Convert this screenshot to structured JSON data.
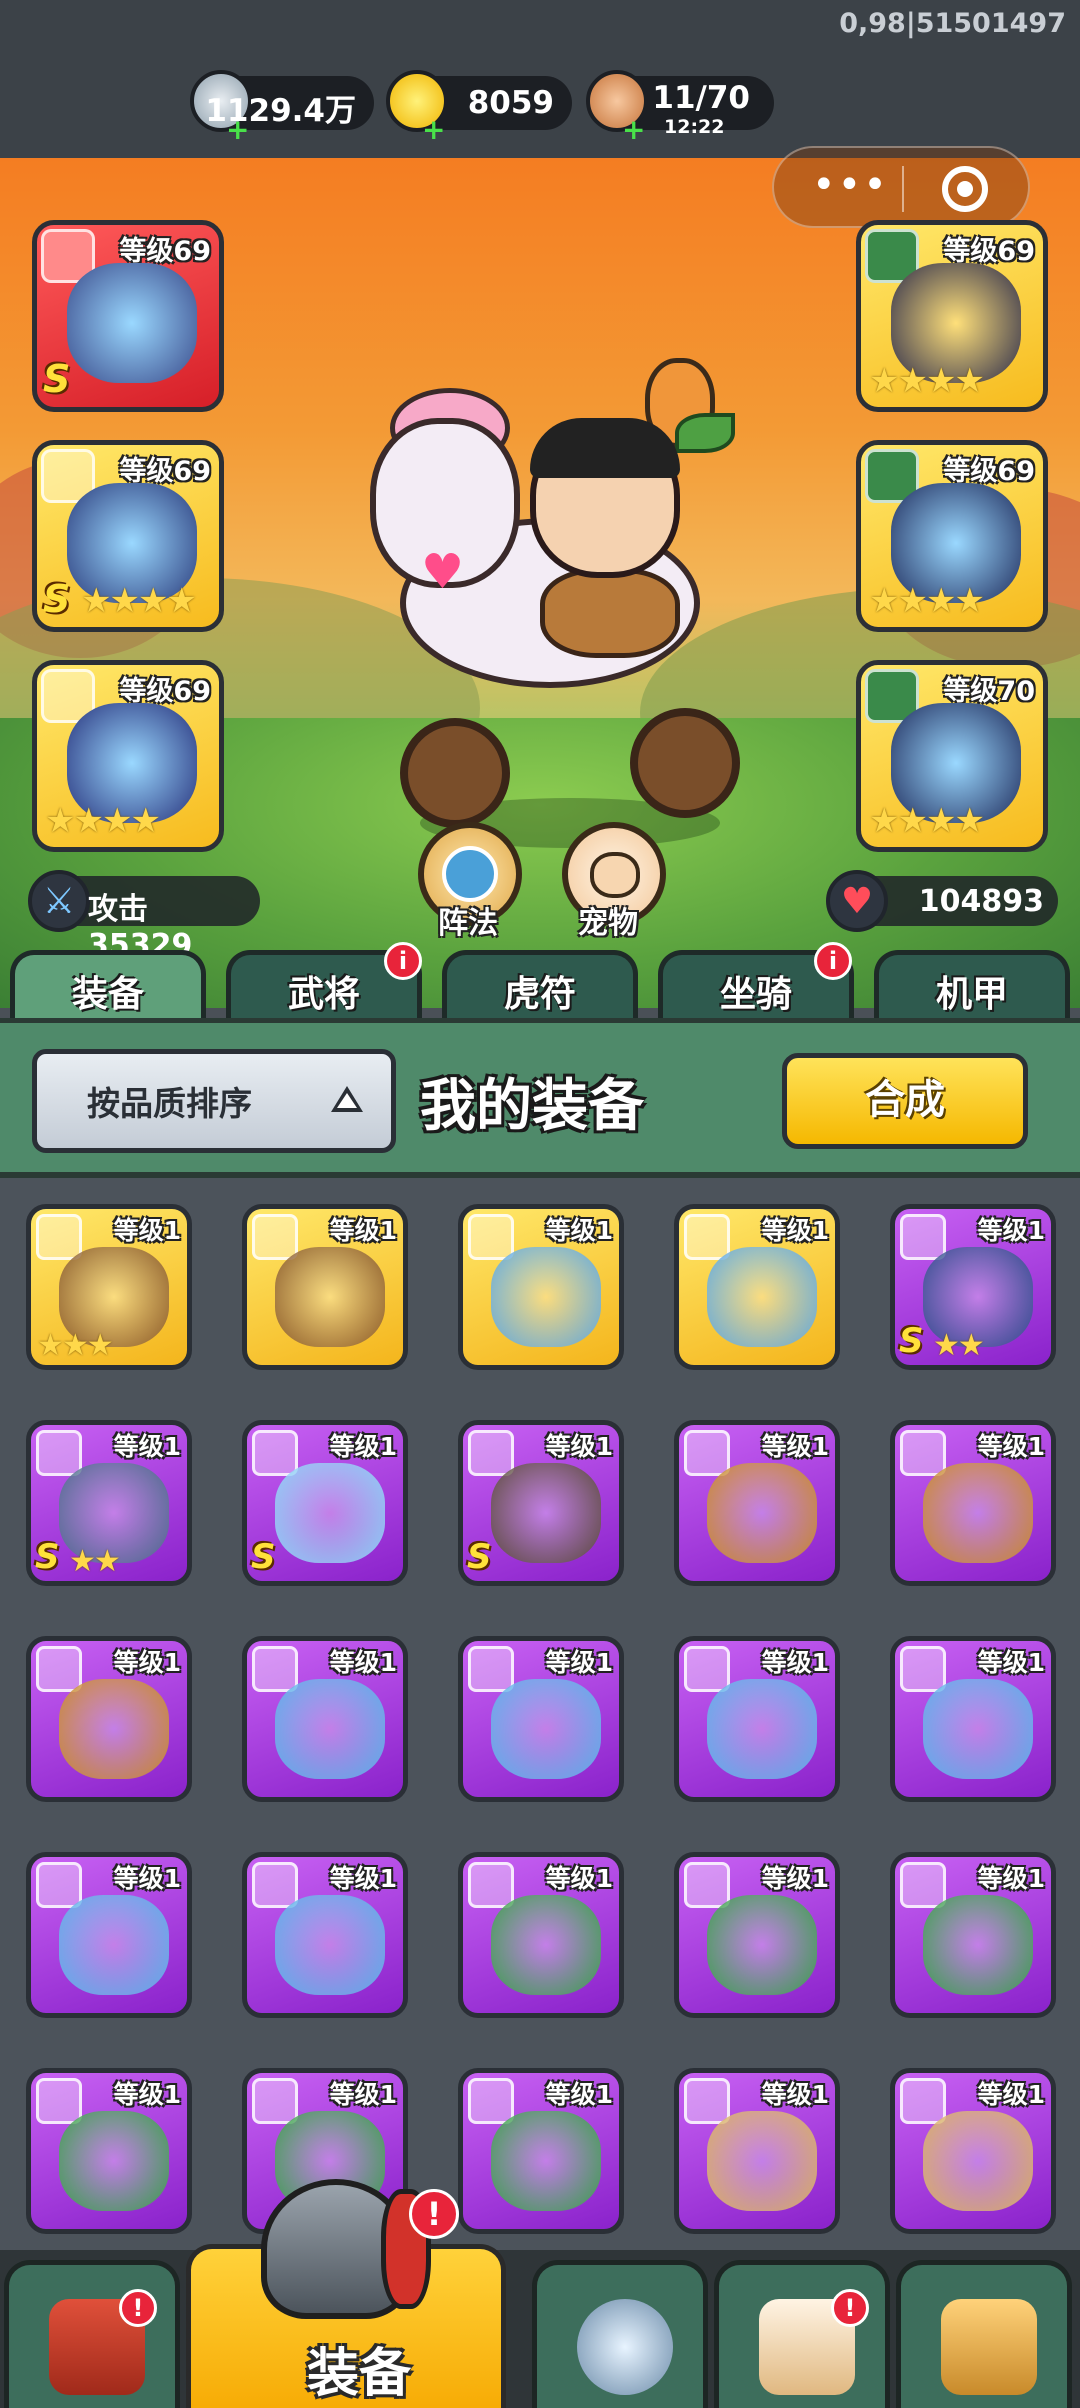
{
  "version_text": "0,98|51501497",
  "resources": {
    "silver": {
      "value": "1129.4万",
      "icon": "silver-coin-icon"
    },
    "gold": {
      "value": "8059",
      "icon": "gold-ingot-icon"
    },
    "stamina": {
      "value": "11/70",
      "timer": "12:22",
      "icon": "meat-icon"
    }
  },
  "capsule": {
    "more_icon": "more-dots-icon",
    "close_icon": "target-close-icon"
  },
  "left_slots": [
    {
      "level": "等级69",
      "grade": "S",
      "stars": "",
      "rarity": "red"
    },
    {
      "level": "等级69",
      "grade": "S",
      "stars": "★★★★",
      "rarity": "gold"
    },
    {
      "level": "等级69",
      "grade": "",
      "stars": "★★★★",
      "rarity": "gold"
    }
  ],
  "right_slots": [
    {
      "level": "等级69",
      "grade": "",
      "stars": "★★★★",
      "rarity": "gold"
    },
    {
      "level": "等级69",
      "grade": "",
      "stars": "★★★★",
      "rarity": "gold"
    },
    {
      "level": "等级70",
      "grade": "",
      "stars": "★★★★",
      "rarity": "gold"
    }
  ],
  "attack_stat": "攻击 35329",
  "hp_stat": "104893",
  "formation_label": "阵法",
  "pet_label": "宠物",
  "tabs": [
    {
      "label": "装备",
      "badge": ""
    },
    {
      "label": "武将",
      "badge": "i"
    },
    {
      "label": "虎符",
      "badge": ""
    },
    {
      "label": "坐骑",
      "badge": "i"
    },
    {
      "label": "机甲",
      "badge": ""
    }
  ],
  "sort_label": "按品质排序",
  "section_title": "我的装备",
  "combine_label": "合成",
  "equipment": [
    {
      "level": "等级1",
      "rarity": "gold",
      "grade": "",
      "stars": "★★★",
      "color": "#8a5a2a"
    },
    {
      "level": "等级1",
      "rarity": "gold",
      "grade": "",
      "stars": "",
      "color": "#8a5a2a"
    },
    {
      "level": "等级1",
      "rarity": "gold",
      "grade": "",
      "stars": "",
      "color": "#5fa8e0"
    },
    {
      "level": "等级1",
      "rarity": "gold",
      "grade": "",
      "stars": "",
      "color": "#5fa8e0"
    },
    {
      "level": "等级1",
      "rarity": "purple",
      "grade": "S",
      "stars": "★★",
      "color": "#2d4b8a"
    },
    {
      "level": "等级1",
      "rarity": "purple",
      "grade": "S",
      "stars": "★★",
      "color": "#4a6a8a"
    },
    {
      "level": "等级1",
      "rarity": "purple",
      "grade": "S",
      "stars": "",
      "color": "#8ad0f5"
    },
    {
      "level": "等级1",
      "rarity": "purple",
      "grade": "S",
      "stars": "",
      "color": "#5a4a3a"
    },
    {
      "level": "等级1",
      "rarity": "purple",
      "grade": "",
      "stars": "",
      "color": "#c88a2a"
    },
    {
      "level": "等级1",
      "rarity": "purple",
      "grade": "",
      "stars": "",
      "color": "#c88a2a"
    },
    {
      "level": "等级1",
      "rarity": "purple",
      "grade": "",
      "stars": "",
      "color": "#c88a2a"
    },
    {
      "level": "等级1",
      "rarity": "purple",
      "grade": "",
      "stars": "",
      "color": "#5ab0e8"
    },
    {
      "level": "等级1",
      "rarity": "purple",
      "grade": "",
      "stars": "",
      "color": "#5ab0e8"
    },
    {
      "level": "等级1",
      "rarity": "purple",
      "grade": "",
      "stars": "",
      "color": "#5ab0e8"
    },
    {
      "level": "等级1",
      "rarity": "purple",
      "grade": "",
      "stars": "",
      "color": "#5ab0e8"
    },
    {
      "level": "等级1",
      "rarity": "purple",
      "grade": "",
      "stars": "",
      "color": "#5ab0e8"
    },
    {
      "level": "等级1",
      "rarity": "purple",
      "grade": "",
      "stars": "",
      "color": "#5ab0e8"
    },
    {
      "level": "等级1",
      "rarity": "purple",
      "grade": "",
      "stars": "",
      "color": "#3aa04a"
    },
    {
      "level": "等级1",
      "rarity": "purple",
      "grade": "",
      "stars": "",
      "color": "#3aa04a"
    },
    {
      "level": "等级1",
      "rarity": "purple",
      "grade": "",
      "stars": "",
      "color": "#3aa04a"
    },
    {
      "level": "等级1",
      "rarity": "purple",
      "grade": "",
      "stars": "",
      "color": "#3aa04a"
    },
    {
      "level": "等级1",
      "rarity": "purple",
      "grade": "",
      "stars": "",
      "color": "#3aa04a"
    },
    {
      "level": "等级1",
      "rarity": "purple",
      "grade": "",
      "stars": "",
      "color": "#3aa04a"
    },
    {
      "level": "等级1",
      "rarity": "purple",
      "grade": "",
      "stars": "",
      "color": "#d8b060"
    },
    {
      "level": "等级1",
      "rarity": "purple",
      "grade": "",
      "stars": "",
      "color": "#d8b060"
    }
  ],
  "nav": [
    {
      "label": "",
      "icon": "gate-icon",
      "badge": "!"
    },
    {
      "label": "装备",
      "icon": "helmet-icon",
      "badge": "!"
    },
    {
      "label": "",
      "icon": "crossed-swords-shield-icon",
      "badge": ""
    },
    {
      "label": "",
      "icon": "horn-icon",
      "badge": "!"
    },
    {
      "label": "",
      "icon": "fist-upgrade-icon",
      "badge": ""
    }
  ],
  "colors": {
    "gold_rarity": "#f7bb1e",
    "purple_rarity": "#8e22cc",
    "red_rarity": "#d61f28",
    "panel_green": "#4f8a6a",
    "combine_yellow": "#f5b800"
  }
}
